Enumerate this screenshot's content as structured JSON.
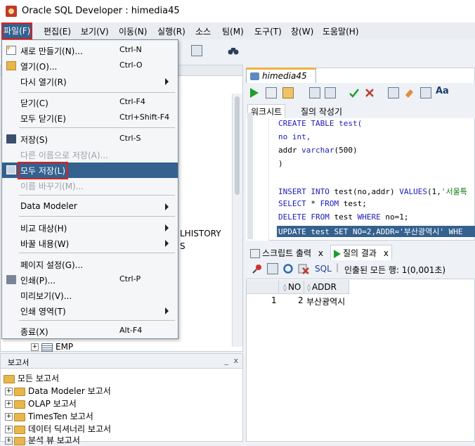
{
  "window": {
    "title": "Oracle SQL Developer : himedia45"
  },
  "menubar": {
    "items": [
      {
        "label": "파일(F)",
        "active": true
      },
      {
        "label": "편집(E)"
      },
      {
        "label": "보기(V)"
      },
      {
        "label": "이동(N)"
      },
      {
        "label": "실행(R)"
      },
      {
        "label": "소스"
      },
      {
        "label": "팀(M)"
      },
      {
        "label": "도구(T)"
      },
      {
        "label": "창(W)"
      },
      {
        "label": "도움말(H)"
      }
    ]
  },
  "file_menu": {
    "items": [
      {
        "label": "새로 만들기(N)...",
        "shortcut": "Ctrl-N",
        "icon": "new-icon"
      },
      {
        "label": "열기(O)...",
        "shortcut": "Ctrl-O",
        "icon": "open-folder-icon"
      },
      {
        "label": "다시 열기(R)",
        "submenu": true
      },
      {
        "label": "닫기(C)",
        "shortcut": "Ctrl-F4"
      },
      {
        "label": "모두 닫기(E)",
        "shortcut": "Ctrl+Shift-F4"
      },
      {
        "label": "저장(S)",
        "shortcut": "Ctrl-S",
        "icon": "save-icon"
      },
      {
        "label": "다른 이름으로 저장(A)...",
        "disabled": true
      },
      {
        "label": "모두 저장(L)",
        "highlighted": true,
        "icon": "save-all-icon"
      },
      {
        "label": "이름 바꾸기(M)...",
        "disabled": true
      },
      {
        "label": "Data Modeler",
        "submenu": true
      },
      {
        "label": "비교 대상(H)",
        "submenu": true
      },
      {
        "label": "바꿀 내용(W)",
        "submenu": true
      },
      {
        "label": "페이지 설정(G)..."
      },
      {
        "label": "인쇄(P)...",
        "shortcut": "Ctrl-P",
        "icon": "print-icon"
      },
      {
        "label": "미리보기(V)..."
      },
      {
        "label": "인쇄 영역(T)",
        "submenu": true
      },
      {
        "label": "종료(X)",
        "shortcut": "Alt-F4"
      }
    ]
  },
  "left_panel": {
    "partial_texts": [
      "LHISTORY",
      "S"
    ],
    "emp_node": "EMP"
  },
  "reports_panel": {
    "title": "보고서",
    "minimize": "_",
    "close": "x",
    "items": [
      {
        "label": "모든 보고서"
      },
      {
        "label": "Data Modeler 보고서"
      },
      {
        "label": "OLAP 보고서"
      },
      {
        "label": "TimesTen 보고서"
      },
      {
        "label": "데이터 딕셔너리 보고서"
      },
      {
        "label": "분석 뷰 보고서"
      }
    ]
  },
  "editor": {
    "tab": "himedia45",
    "subtabs": [
      "워크시트",
      "질의 작성기"
    ],
    "lines": [
      "CREATE TABLE test(",
      "no int,",
      "addr varchar(500)",
      ")",
      "",
      "INSERT INTO test(no,addr) VALUES(1,'서울특",
      "SELECT * FROM test;",
      "DELETE FROM test WHERE no=1;",
      "UPDATE test SET NO=2,ADDR='부산광역시' WHE"
    ]
  },
  "results": {
    "tabs": [
      {
        "label": "스크립트 출력",
        "close": "x"
      },
      {
        "label": "질의 결과",
        "close": "x"
      }
    ],
    "sql_label": "SQL",
    "status": "인출된 모든 행: 1(0,001초)",
    "columns": [
      "NO",
      "ADDR"
    ],
    "rows": [
      {
        "index": "1",
        "no": "2",
        "addr": "부산광역시"
      }
    ]
  },
  "colors": {
    "highlight": "#34618e",
    "annotation": "#e01c1c",
    "keyword": "#1c1cb8",
    "string": "#0f7a0f"
  }
}
